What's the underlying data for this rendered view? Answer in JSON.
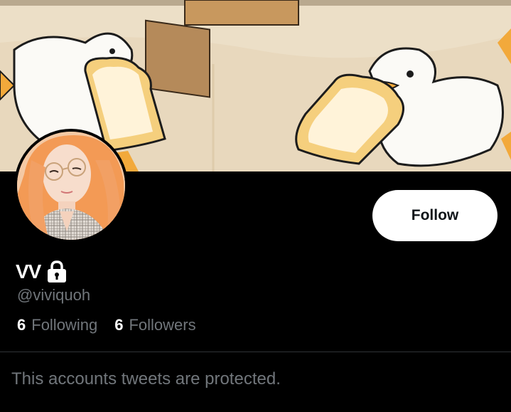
{
  "profile": {
    "display_name": "VV",
    "handle": "@viviquoh",
    "protected": true
  },
  "stats": {
    "following_count": "6",
    "following_label": "Following",
    "followers_count": "6",
    "followers_label": "Followers"
  },
  "actions": {
    "follow_label": "Follow"
  },
  "timeline": {
    "protected_message": "This accounts tweets are protected."
  },
  "icons": {
    "lock": "lock-icon"
  },
  "colors": {
    "background": "#000000",
    "secondary_text": "#71767b",
    "button_bg": "#ffffff",
    "button_text": "#0f1419"
  }
}
